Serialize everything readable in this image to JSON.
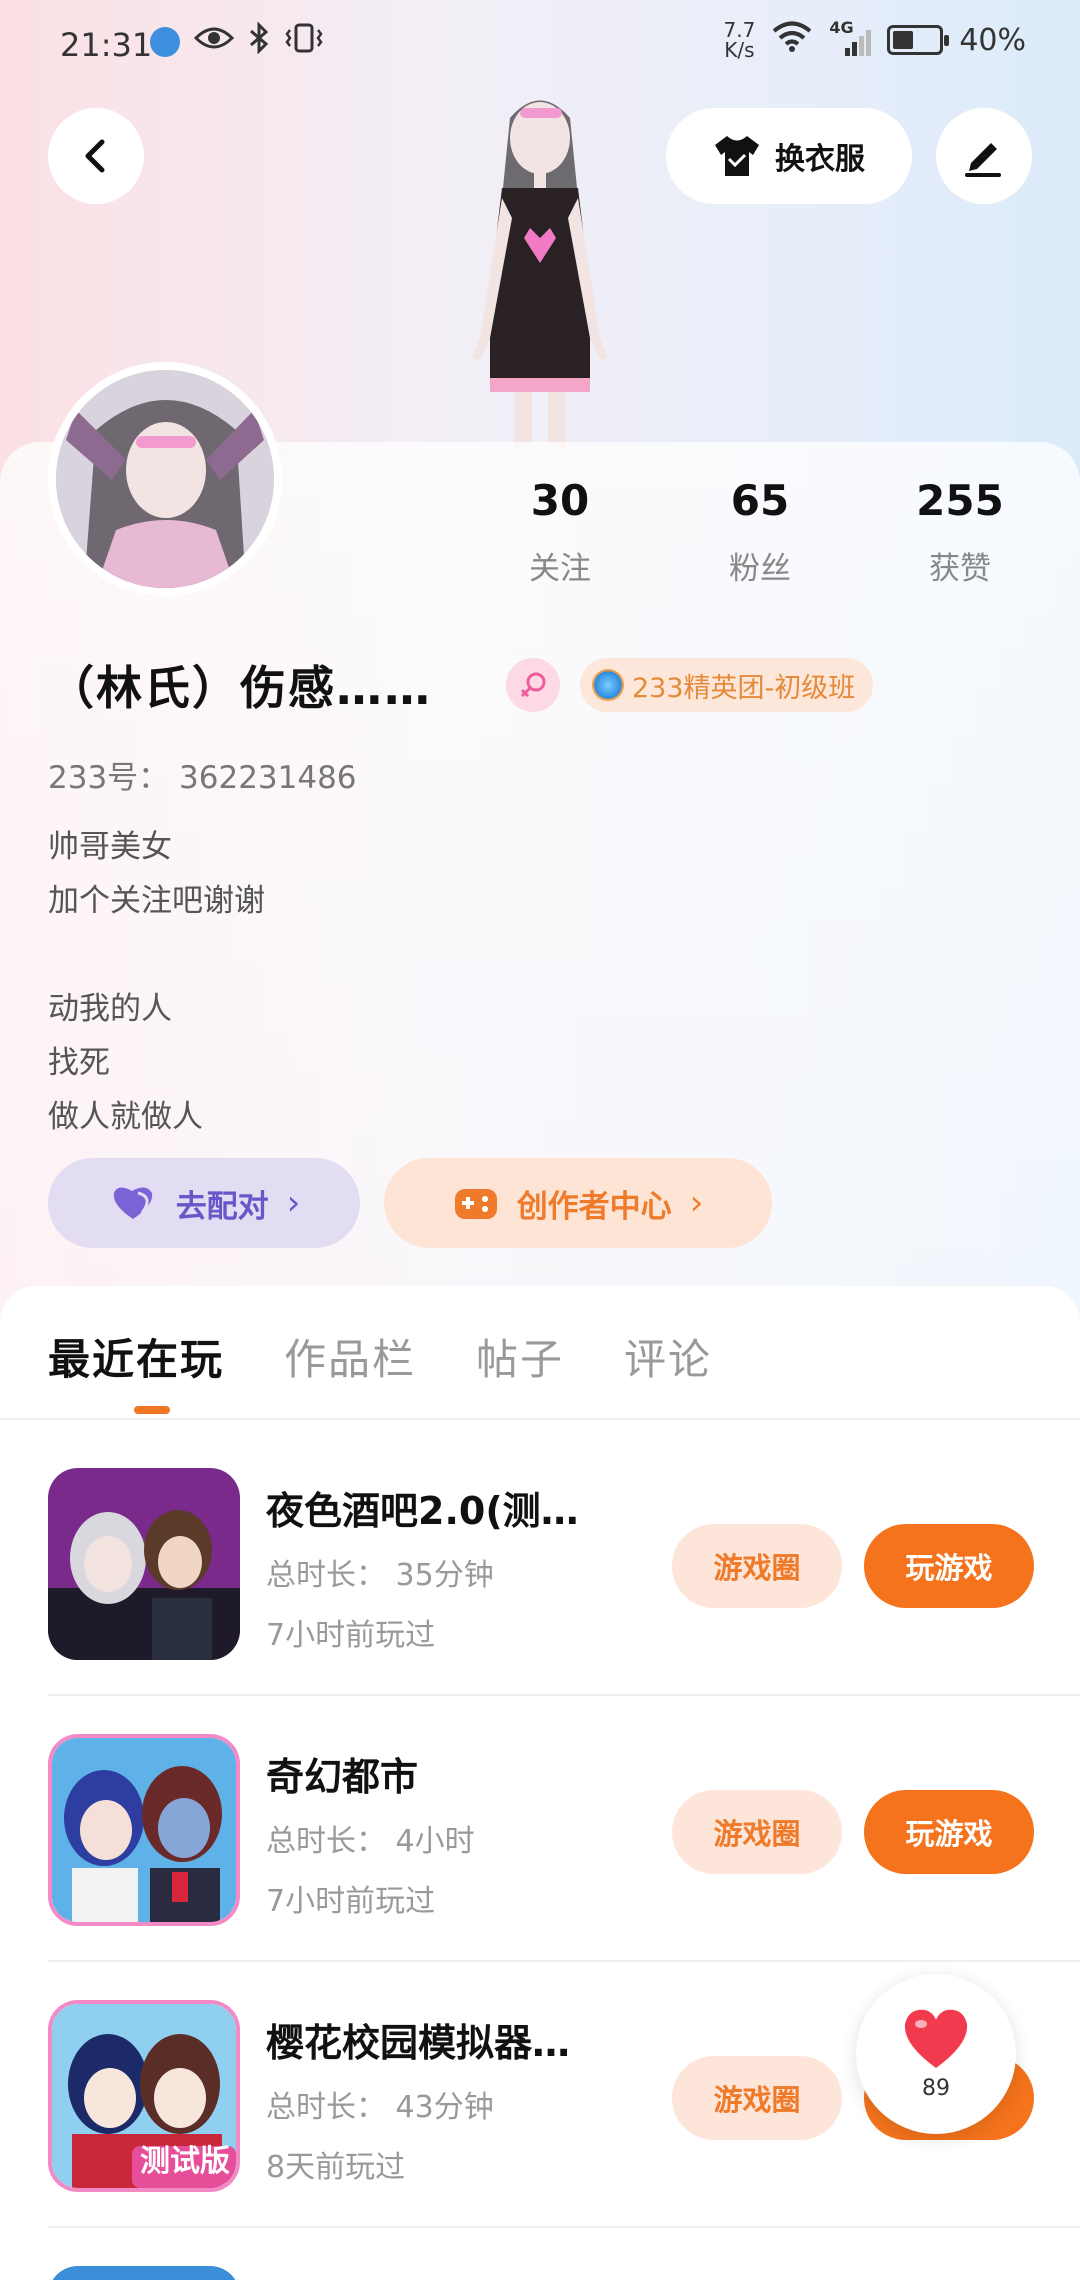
{
  "status_bar": {
    "time": "21:31",
    "net_speed": "7.7\nK/s",
    "network": "4G",
    "battery": "40%"
  },
  "header": {
    "outfit_label": "换衣服"
  },
  "profile": {
    "stats": [
      {
        "value": "30",
        "label": "关注"
      },
      {
        "value": "65",
        "label": "粉丝"
      },
      {
        "value": "255",
        "label": "获赞"
      }
    ],
    "name": "（林氏）伤感……",
    "elite_badge": "233精英团-初级班",
    "uid": "233号：  362231486",
    "bio": "帅哥美女\n加个关注吧谢谢\n\n动我的人\n找死\n做人就做人",
    "match_label": "去配对",
    "creator_label": "创作者中心"
  },
  "tabs": [
    "最近在玩",
    "作品栏",
    "帖子",
    "评论"
  ],
  "games": [
    {
      "title": "夜色酒吧2.0(测…",
      "duration": "总时长：  35分钟",
      "last_played": "7小时前玩过",
      "circle_label": "游戏圈",
      "play_label": "玩游戏"
    },
    {
      "title": "奇幻都市",
      "duration": "总时长：  4小时",
      "last_played": "7小时前玩过",
      "circle_label": "游戏圈",
      "play_label": "玩游戏"
    },
    {
      "title": "樱花校园模拟器…",
      "duration": "总时长：  43分钟",
      "last_played": "8天前玩过",
      "circle_label": "游戏圈",
      "play_label": "玩游戏",
      "icon_text": "测试版"
    }
  ],
  "like_float": {
    "count": "89"
  },
  "colors": {
    "accent": "#f4731c",
    "accent_soft": "#fde6d9",
    "match": "#6a55c9",
    "match_bg": "#e3ddf3"
  }
}
